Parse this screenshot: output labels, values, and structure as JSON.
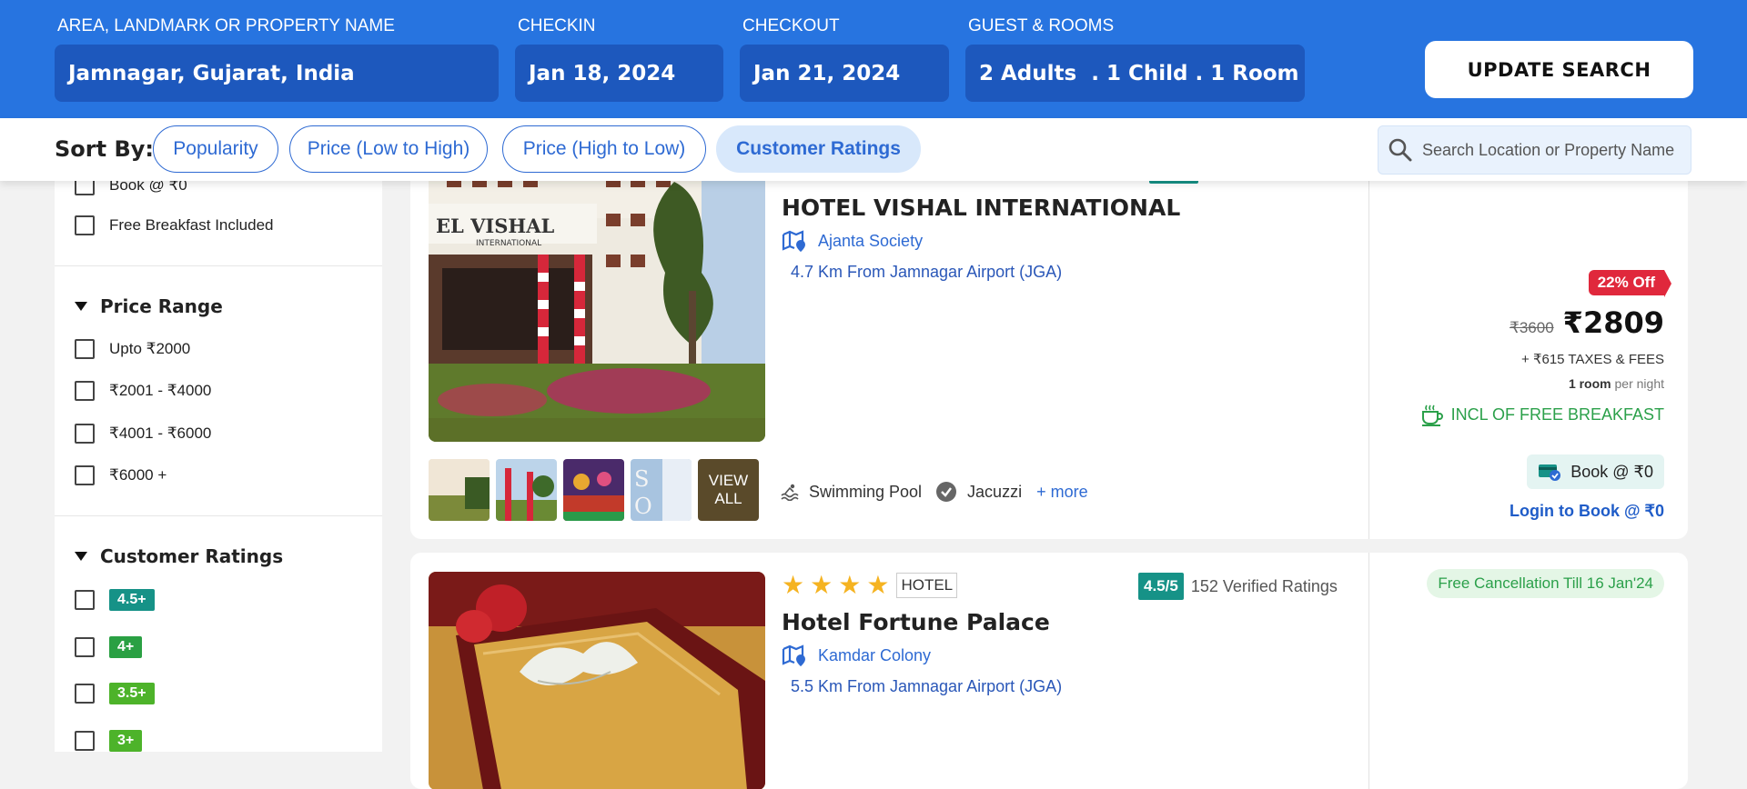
{
  "search": {
    "area_label": "AREA, LANDMARK OR PROPERTY NAME",
    "area_value": "Jamnagar, Gujarat, India",
    "checkin_label": "CHECKIN",
    "checkin_value": "Jan 18, 2024",
    "checkout_label": "CHECKOUT",
    "checkout_value": "Jan 21, 2024",
    "guests_label": "GUEST & ROOMS",
    "guests_value": "2 Adults  . 1 Child . 1 Room",
    "update_label": "UPDATE SEARCH"
  },
  "sort": {
    "label": "Sort By:",
    "options": [
      "Popularity",
      "Price (Low to High)",
      "Price (High to Low)",
      "Customer Ratings"
    ],
    "active": "Customer Ratings",
    "search_placeholder": "Search Location or Property Name"
  },
  "sidebar": {
    "top_options": [
      "Book @ ₹0",
      "Free Breakfast Included"
    ],
    "price_range": {
      "title": "Price Range",
      "options": [
        "Upto ₹2000",
        "₹2001 - ₹4000",
        "₹4001 - ₹6000",
        "₹6000 +"
      ]
    },
    "customer_ratings": {
      "title": "Customer Ratings",
      "options": [
        "4.5+",
        "4+",
        "3.5+",
        "3+"
      ],
      "colors": [
        "#169287",
        "#2aa043",
        "#4db32a",
        "#4db32a"
      ]
    }
  },
  "hotels": [
    {
      "name": "HOTEL VISHAL INTERNATIONAL",
      "locality": "Ajanta Society",
      "distance": "4.7 Km From Jamnagar Airport (JGA)",
      "photo_sign": "EL VISHAL",
      "photo_sign_sub": "INTERNATIONAL",
      "view_all": "VIEW ALL",
      "amenities": [
        "Swimming Pool",
        "Jacuzzi"
      ],
      "more": "+ more",
      "discount": "22% Off",
      "old_price": "₹3600",
      "price": "₹2809",
      "taxes": "+ ₹615 TAXES & FEES",
      "room_bold": "1 room",
      "per_night": "per night",
      "breakfast": "INCL OF FREE BREAKFAST",
      "book": "Book @ ₹0",
      "login": "Login to Book @ ₹0"
    },
    {
      "name": "Hotel Fortune Palace",
      "stars": 4,
      "type": "HOTEL",
      "rating": "4.5/5",
      "rating_count": "152 Verified Ratings",
      "locality": "Kamdar Colony",
      "distance": "5.5 Km From Jamnagar Airport (JGA)",
      "free_cancel": "Free Cancellation Till 16 Jan'24"
    }
  ],
  "colors": {
    "header_bg": "#2774e0",
    "field_bg": "#1d58bd",
    "accent_blue": "#2e6ad3",
    "discount_red": "#e0283c",
    "green": "#2ba04a",
    "rating_teal": "#169287"
  }
}
